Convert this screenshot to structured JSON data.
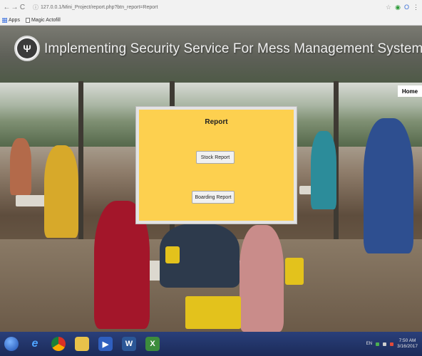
{
  "browser": {
    "back": "←",
    "forward": "→",
    "reload": "C",
    "url": "127.0.0.1/Mini_Project/report.php?btn_report=Report",
    "bookmarks": [
      {
        "label": "Apps"
      },
      {
        "label": "Magic Actofill"
      }
    ]
  },
  "site": {
    "title": "Implementing Security Service For Mess Management System Using PHP.",
    "logo_glyph": "Ψ",
    "home_label": "Home"
  },
  "report": {
    "title": "Report",
    "stock_label": "Stock Report",
    "boarding_label": "Boarding Report"
  },
  "taskbar": {
    "lang": "EN",
    "time": "7:50 AM",
    "date": "3/16/2017"
  }
}
